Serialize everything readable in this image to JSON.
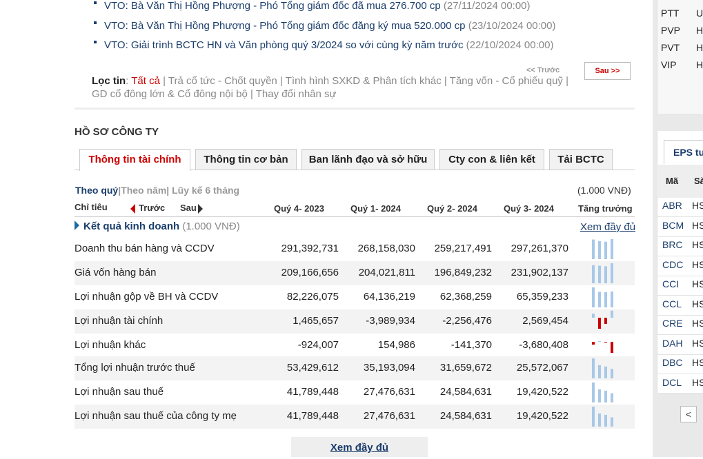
{
  "news": [
    {
      "text": "VTO: Bà Văn Thị Hồng Phượng - Phó Tổng giám đốc đã mua 276.700 cp",
      "date": "(27/11/2024 00:00)"
    },
    {
      "text": "VTO: Bà Văn Thị Hồng Phượng - Phó Tổng giám đốc đăng ký mua 520.000 cp",
      "date": "(23/10/2024 00:00)"
    },
    {
      "text": "VTO: Giải trình BCTC HN và Văn phòng quý 3/2024 so với cùng kỳ năm trước",
      "date": "(22/10/2024 00:00)"
    }
  ],
  "filter": {
    "label": "Lọc tin",
    "colon": ":",
    "active": "Tất cả",
    "rest": " | Trả cổ tức - Chốt quyền | Tình hình SXKD & Phân tích khác | Tăng vốn - Cổ phiếu quỹ | GD cổ đông lớn & Cổ đông nội bộ | Thay đổi nhân sự"
  },
  "pager": {
    "prev": "<< Trước",
    "next": "Sau >>"
  },
  "section_title": "HỒ SƠ CÔNG TY",
  "tabs": [
    {
      "label": "Thông tin tài chính"
    },
    {
      "label": "Thông tin cơ bản"
    },
    {
      "label": "Ban lãnh đạo và sở hữu"
    },
    {
      "label": "Cty con & liên kết"
    },
    {
      "label": "Tải BCTC"
    }
  ],
  "period": {
    "quarter": "Theo quý",
    "sep1": "|",
    "year": "Theo năm",
    "sep2": "|",
    "cumulative": " Lũy kế 6 tháng"
  },
  "unit_right": "(1.000 VNĐ)",
  "header": {
    "indicator": "Chỉ tiêu",
    "prev": "Trước",
    "next": "Sau",
    "cols": [
      "Quý 4- 2023",
      "Quý 1- 2024",
      "Quý 2- 2024",
      "Quý 3- 2024"
    ],
    "growth": "Tăng trưởng"
  },
  "group": {
    "title": "Kết quả kinh doanh",
    "unit": " (1.000 VNĐ)",
    "more": "Xem đầy đủ"
  },
  "rows": [
    {
      "label": "Doanh thu bán hàng và CCDV",
      "values": [
        "291,392,731",
        "268,158,030",
        "259,217,491",
        "297,261,370"
      ],
      "nums": [
        291392731,
        268158030,
        259217491,
        297261370
      ]
    },
    {
      "label": "Giá vốn hàng bán",
      "values": [
        "209,166,656",
        "204,021,811",
        "196,849,232",
        "231,902,137"
      ],
      "nums": [
        209166656,
        204021811,
        196849232,
        231902137
      ]
    },
    {
      "label": "Lợi nhuận gộp về BH và CCDV",
      "values": [
        "82,226,075",
        "64,136,219",
        "62,368,259",
        "65,359,233"
      ],
      "nums": [
        82226075,
        64136219,
        62368259,
        65359233
      ]
    },
    {
      "label": "Lợi nhuận tài chính",
      "values": [
        "1,465,657",
        "-3,989,934",
        "-2,256,476",
        "2,569,454"
      ],
      "nums": [
        1465657,
        -3989934,
        -2256476,
        2569454
      ]
    },
    {
      "label": "Lợi nhuận khác",
      "values": [
        "-924,007",
        "154,986",
        "-141,370",
        "-3,680,408"
      ],
      "nums": [
        -924007,
        154986,
        -141370,
        -3680408
      ]
    },
    {
      "label": "Tổng lợi nhuận trước thuế",
      "values": [
        "53,429,612",
        "35,193,094",
        "31,659,672",
        "25,572,067"
      ],
      "nums": [
        53429612,
        35193094,
        31659672,
        25572067
      ]
    },
    {
      "label": "Lợi nhuận sau thuế",
      "values": [
        "41,789,448",
        "27,476,631",
        "24,584,631",
        "19,420,522"
      ],
      "nums": [
        41789448,
        27476631,
        24584631,
        19420522
      ]
    },
    {
      "label": "Lợi nhuận sau thuế của công ty mẹ",
      "values": [
        "41,789,448",
        "27,476,631",
        "24,584,631",
        "19,420,522"
      ],
      "nums": [
        41789448,
        27476631,
        24584631,
        19420522
      ]
    }
  ],
  "bottom_more": "Xem đầy đủ",
  "colors": {
    "positive": "#a8c8e8",
    "negative": "#cc0000"
  },
  "right_top": [
    {
      "code": "PTT",
      "x": "U"
    },
    {
      "code": "PVP",
      "x": "H"
    },
    {
      "code": "PVT",
      "x": "H"
    },
    {
      "code": "VIP",
      "x": "H"
    }
  ],
  "right_tab": "EPS tu",
  "right_head": {
    "c1": "Mã",
    "c2": "Sà"
  },
  "right_list": [
    {
      "code": "ABR",
      "x": "HS"
    },
    {
      "code": "BCM",
      "x": "HS"
    },
    {
      "code": "BRC",
      "x": "HS"
    },
    {
      "code": "CDC",
      "x": "HS"
    },
    {
      "code": "CCI",
      "x": "HS"
    },
    {
      "code": "CCL",
      "x": "HS"
    },
    {
      "code": "CRE",
      "x": "HS"
    },
    {
      "code": "DAH",
      "x": "HS"
    },
    {
      "code": "DBC",
      "x": "HS"
    },
    {
      "code": "DCL",
      "x": "HS"
    }
  ],
  "right_pager": "<"
}
